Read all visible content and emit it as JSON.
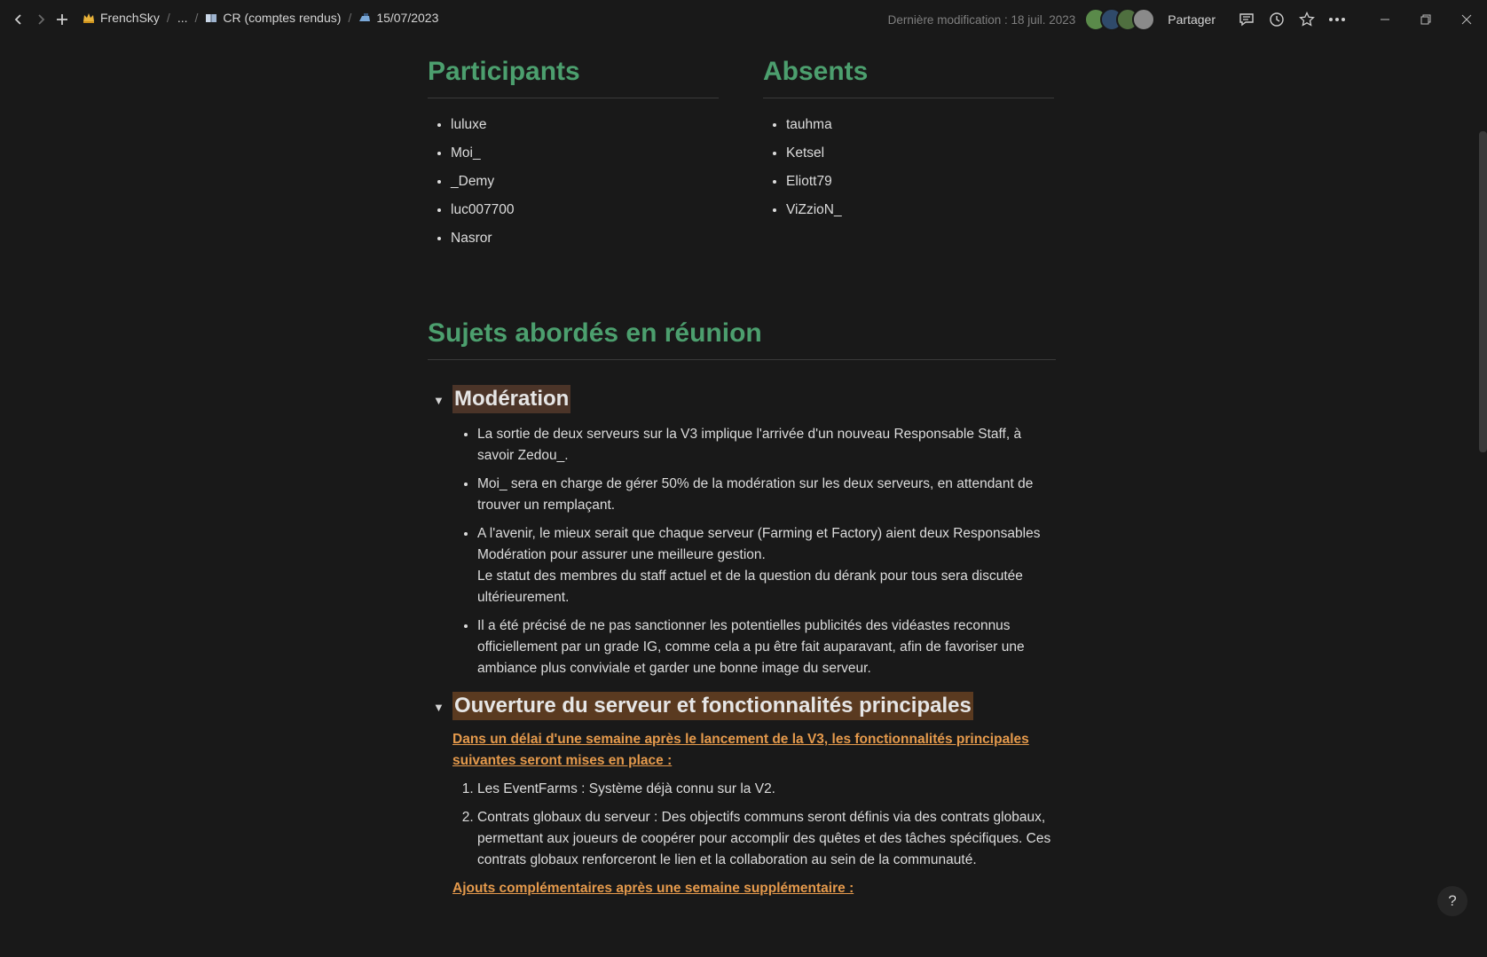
{
  "breadcrumb": {
    "workspace": "FrenchSky",
    "ellipsis": "...",
    "parent": "CR (comptes rendus)",
    "current": "15/07/2023"
  },
  "topbar": {
    "last_modified": "Dernière modification : 18 juil. 2023",
    "share_label": "Partager",
    "avatar_colors": [
      "#5a8a4a",
      "#2f4a6a",
      "#4f6f3f",
      "#8a8a8a"
    ]
  },
  "participants": {
    "title": "Participants",
    "items": [
      "luluxe",
      "Moi_",
      "_Demy",
      "luc007700",
      "Nasror"
    ]
  },
  "absents": {
    "title": "Absents",
    "items": [
      "tauhma",
      "Ketsel",
      "Eliott79",
      "ViZzioN_"
    ]
  },
  "topics": {
    "title": "Sujets abordés en réunion",
    "moderation": {
      "title": "Modération",
      "bullets": [
        "La sortie de deux serveurs sur la V3 implique l'arrivée d'un nouveau Responsable Staff, à savoir Zedou_.",
        "Moi_ sera en charge de gérer 50% de la modération sur les deux serveurs, en attendant de trouver un remplaçant.",
        "A l'avenir, le mieux serait que chaque serveur (Farming et Factory) aient deux Responsables Modération pour assurer une meilleure gestion.",
        "Le statut des membres du staff actuel et de la question du dérank pour tous sera discutée ultérieurement.",
        "Il a été précisé de ne pas sanctionner les potentielles publicités des vidéastes reconnus officiellement par un grade IG, comme cela a pu être fait auparavant, afin de favoriser une ambiance plus conviviale et garder une bonne image du serveur."
      ]
    },
    "opening": {
      "title": "Ouverture du serveur et fonctionnalités principales",
      "intro": "Dans un délai d'une semaine après le lancement de la V3, les fonctionnalités principales suivantes seront mises en place :",
      "items": [
        "Les EventFarms : Système déjà connu sur la V2.",
        "Contrats globaux du serveur : Des objectifs communs seront définis via des contrats globaux, permettant aux joueurs de coopérer pour accomplir des quêtes et des tâches spécifiques. Ces contrats globaux renforceront le lien et la collaboration au sein de la communauté."
      ],
      "extra": "Ajouts complémentaires après une semaine supplémentaire :"
    }
  },
  "help_label": "?"
}
